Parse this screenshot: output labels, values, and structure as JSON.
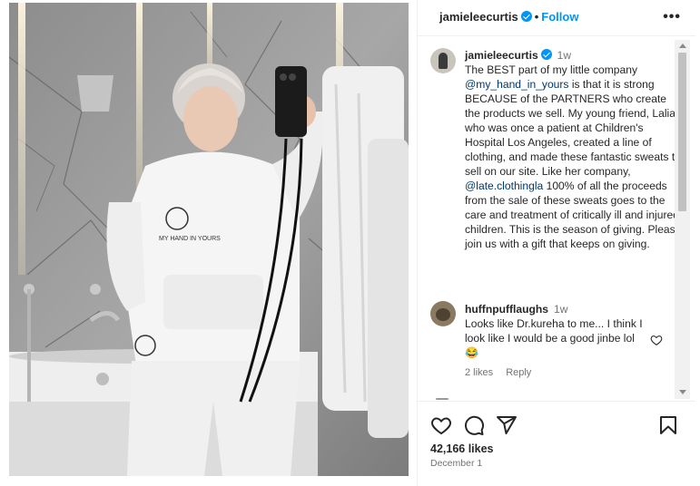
{
  "header": {
    "username": "jamieleecurtis",
    "separator": "•",
    "follow_label": "Follow",
    "more_label": "•••"
  },
  "caption": {
    "username": "jamieleecurtis",
    "age": "1w",
    "text_1": "The BEST part of my little company ",
    "mention_1": "@my_hand_in_yours",
    "text_2": " is that it is strong BECAUSE of the PARTNERS who create the products we sell. My young friend, Lalia, who was once a patient at Children's Hospital Los Angeles, created a line of clothing, and made these fantastic sweats to sell on our site. Like her company, ",
    "mention_2": "@late.clothingla",
    "text_3": " 100% of all the proceeds from the sale of these sweats goes to the care and treatment of critically ill and injured children. This is the season of giving. Please join us with a gift that keeps on giving."
  },
  "comment": {
    "username": "huffnpufflaughs",
    "age": "1w",
    "text": "Looks like Dr.kureha to me... I think I look like I would be a good jinbe lol 😂",
    "likes_label": "2 likes",
    "reply_label": "Reply"
  },
  "footer": {
    "likes": "42,166 likes",
    "date": "December 1"
  },
  "photo": {
    "hoodie_print": "MY HAND IN YOURS"
  },
  "colors": {
    "accent": "#0095f6",
    "mention": "#00376b",
    "secondary_text": "#737373"
  },
  "icons": [
    "verified-badge-icon",
    "more-options-icon",
    "heart-icon",
    "comment-icon",
    "share-icon",
    "bookmark-icon"
  ]
}
